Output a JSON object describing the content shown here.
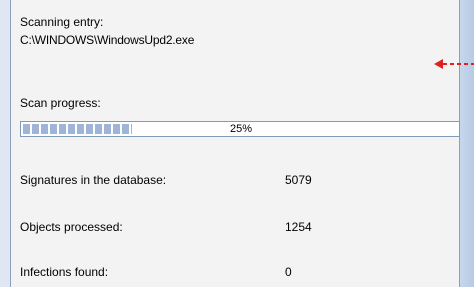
{
  "scan": {
    "entry_label": "Scanning entry:",
    "entry_path": "C:\\WINDOWS\\WindowsUpd2.exe",
    "progress_label": "Scan progress:",
    "progress_percent": 25,
    "progress_text": "25%"
  },
  "stats": {
    "signatures_label": "Signatures in the database:",
    "signatures_value": "5079",
    "objects_label": "Objects processed:",
    "objects_value": "1254",
    "infections_label": "Infections found:",
    "infections_value": "0"
  },
  "colors": {
    "panel_bg": "#f3f3f3",
    "progress_fill": "#9fb4d6",
    "arrow": "#e02020"
  },
  "icons": {
    "arrow": "dashed-arrow-left-icon"
  }
}
